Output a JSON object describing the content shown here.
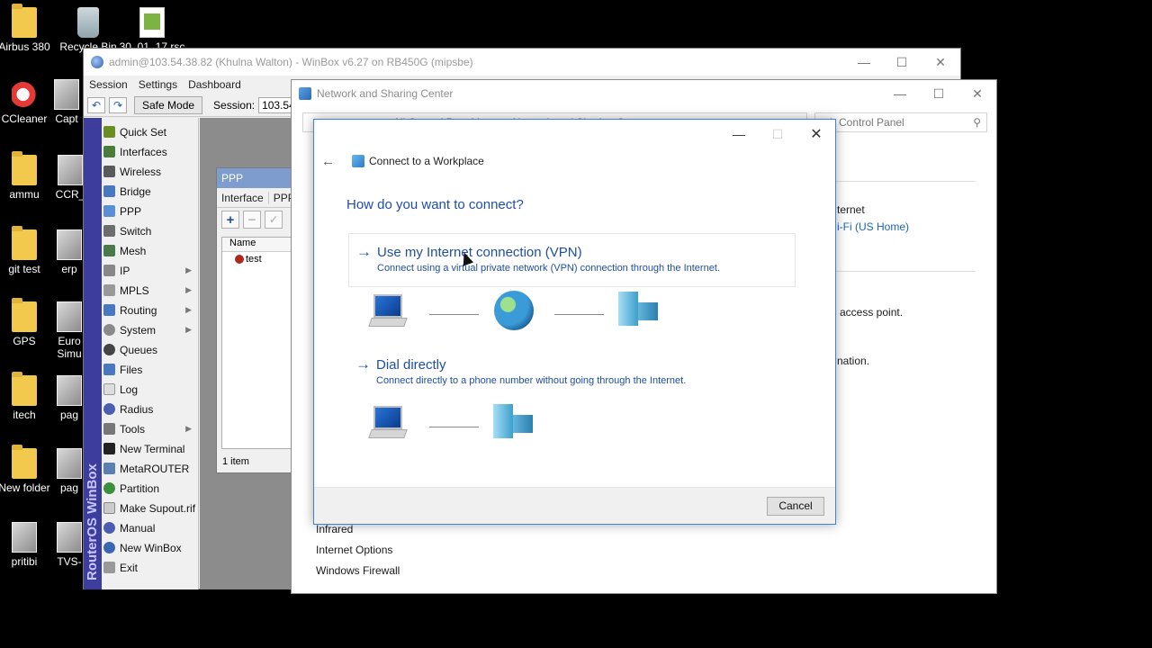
{
  "desktop": {
    "icons": [
      {
        "label": "Airbus 380",
        "icon": "folder-icon"
      },
      {
        "label": "Recycle Bin",
        "icon": "recycle-bin-icon"
      },
      {
        "label": "30_01_17.rsc",
        "icon": "document-icon"
      },
      {
        "label": "CCleaner",
        "icon": "ccleaner-icon"
      },
      {
        "label": "Capt",
        "icon": "app-icon"
      },
      {
        "label": "ammu",
        "icon": "folder-icon"
      },
      {
        "label": "CCR_",
        "icon": "app-icon"
      },
      {
        "label": "git test",
        "icon": "folder-icon"
      },
      {
        "label": "erp",
        "icon": "app-icon"
      },
      {
        "label": "GPS",
        "icon": "folder-icon"
      },
      {
        "label": "Euro",
        "icon": "app-icon"
      },
      {
        "label": "Simu",
        "icon": "app-icon"
      },
      {
        "label": "itech",
        "icon": "folder-icon"
      },
      {
        "label": "pag",
        "icon": "app-icon"
      },
      {
        "label": "New folder",
        "icon": "folder-icon"
      },
      {
        "label": "pag",
        "icon": "app-icon"
      },
      {
        "label": "pritibi",
        "icon": "app-icon"
      },
      {
        "label": "TVS-",
        "icon": "app-icon"
      }
    ]
  },
  "winbox": {
    "title": "admin@103.54.38.82 (Khulna Walton) - WinBox v6.27 on RB450G (mipsbe)",
    "menu": [
      "Session",
      "Settings",
      "Dashboard"
    ],
    "toolbar": {
      "undo": "↶",
      "redo": "↷",
      "safe_mode": "Safe Mode",
      "session_label": "Session:",
      "session_value": "103.54.38.8"
    },
    "brand": "RouterOS WinBox",
    "sidebar": [
      "Quick Set",
      "Interfaces",
      "Wireless",
      "Bridge",
      "PPP",
      "Switch",
      "Mesh",
      "IP",
      "MPLS",
      "Routing",
      "System",
      "Queues",
      "Files",
      "Log",
      "Radius",
      "Tools",
      "New Terminal",
      "MetaROUTER",
      "Partition",
      "Make Supout.rif",
      "Manual",
      "New WinBox",
      "Exit"
    ],
    "ppp": {
      "title": "PPP",
      "tabs": [
        "Interface",
        "PPPo"
      ],
      "add": "+",
      "remove": "−",
      "check": "✓",
      "column": "Name",
      "row": "test",
      "status": "1 item"
    }
  },
  "nsc": {
    "title": "Network and Sharing Center",
    "path": "All Control Panel Items  ›  Network and Sharing Center",
    "search_placeholder": "rch Control Panel",
    "search_icon": "⚲",
    "right_text": {
      "internet": "ternet",
      "wifi_link": "i-Fi (US Home)",
      "access_point": "access point.",
      "information": "nation."
    },
    "see_also": [
      "Infrared",
      "Internet Options",
      "Windows Firewall"
    ]
  },
  "dialog": {
    "title": "Connect to a Workplace",
    "question": "How do you want to connect?",
    "options": [
      {
        "title": "Use my Internet connection (VPN)",
        "desc": "Connect using a virtual private network (VPN) connection through the Internet."
      },
      {
        "title": "Dial directly",
        "desc": "Connect directly to a phone number without going through the Internet."
      }
    ],
    "cancel": "Cancel"
  }
}
